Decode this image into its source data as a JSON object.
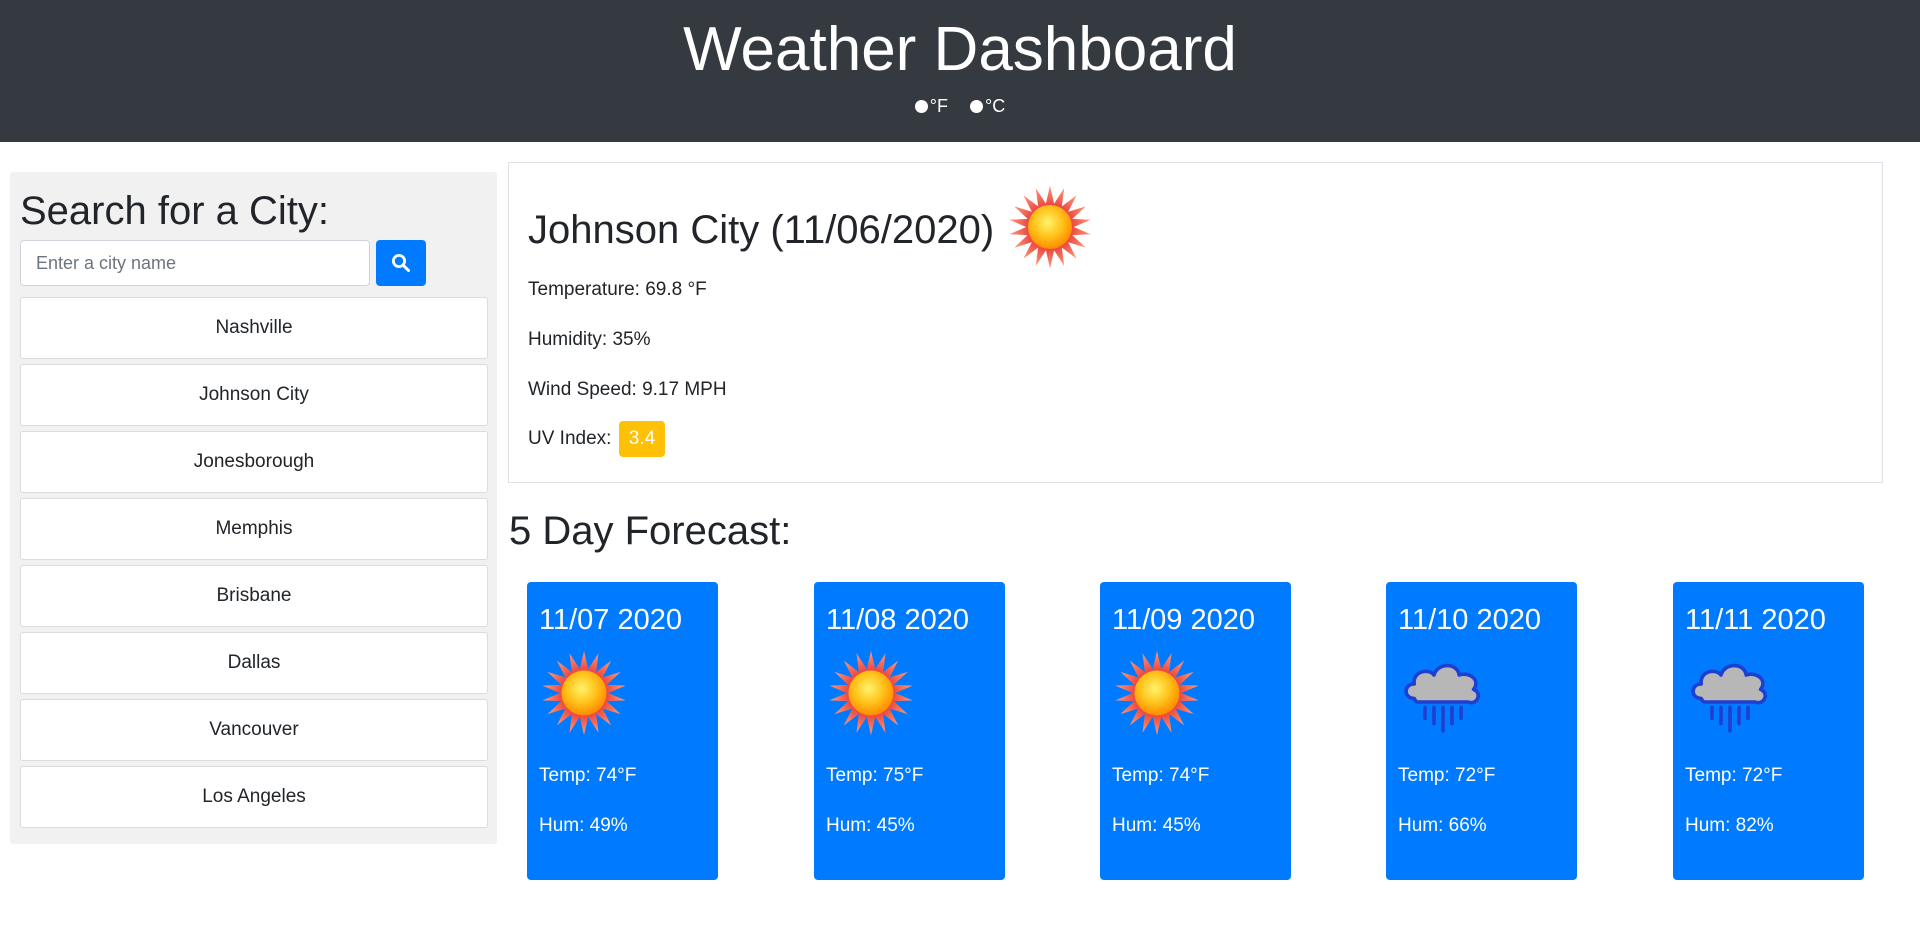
{
  "header": {
    "title": "Weather Dashboard",
    "unit_f": "°F",
    "unit_c": "°C"
  },
  "sidebar": {
    "heading": "Search for a City:",
    "search_placeholder": "Enter a city name",
    "search_icon": "search-icon",
    "cities": [
      "Nashville",
      "Johnson City",
      "Jonesborough",
      "Memphis",
      "Brisbane",
      "Dallas",
      "Vancouver",
      "Los Angeles"
    ]
  },
  "current": {
    "title": "Johnson City (11/06/2020)",
    "icon": "sun-icon",
    "temperature": "Temperature: 69.8 °F",
    "humidity": "Humidity: 35%",
    "wind": "Wind Speed: 9.17 MPH",
    "uv_label": "UV Index:",
    "uv_value": "3.4",
    "uv_color": "#ffc107"
  },
  "forecast": {
    "title": "5 Day Forecast:",
    "card_color": "#007bff",
    "days": [
      {
        "date": "11/07 2020",
        "icon": "sun-icon",
        "temp": "Temp: 74°F",
        "hum": "Hum: 49%"
      },
      {
        "date": "11/08 2020",
        "icon": "sun-icon",
        "temp": "Temp: 75°F",
        "hum": "Hum: 45%"
      },
      {
        "date": "11/09 2020",
        "icon": "sun-icon",
        "temp": "Temp: 74°F",
        "hum": "Hum: 45%"
      },
      {
        "date": "11/10 2020",
        "icon": "rain-cloud-icon",
        "temp": "Temp: 72°F",
        "hum": "Hum: 66%"
      },
      {
        "date": "11/11 2020",
        "icon": "rain-cloud-icon",
        "temp": "Temp: 72°F",
        "hum": "Hum: 82%"
      }
    ]
  }
}
